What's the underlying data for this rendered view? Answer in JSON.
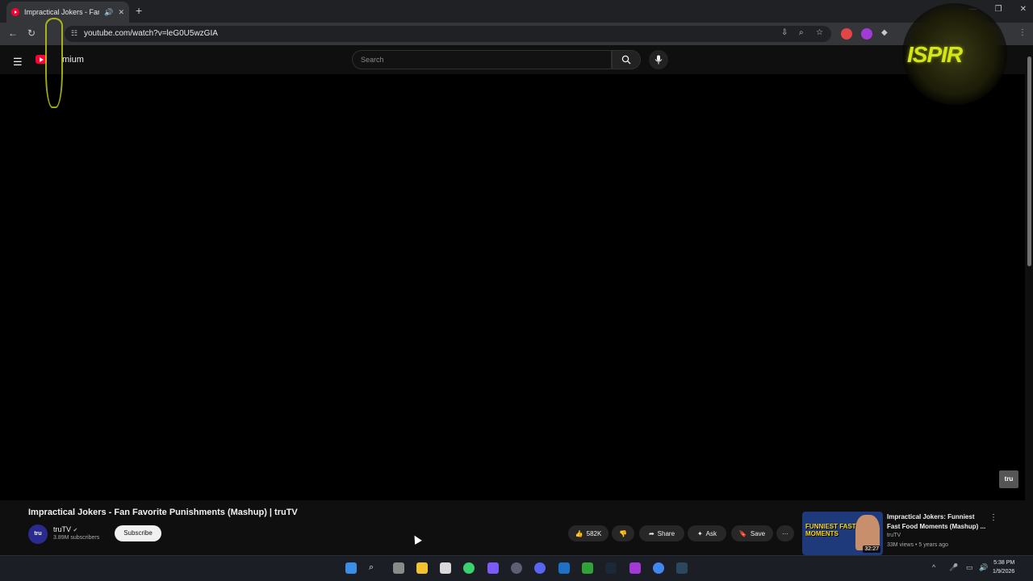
{
  "browser": {
    "tab_title": "Impractical Jokers - Fan Fav",
    "url": "youtube.com/watch?v=leG0U5wzGIA",
    "new_tab_label": "+",
    "icons": [
      "back-icon",
      "reload-icon",
      "install-icon",
      "zoom-icon",
      "bookmark-star-icon",
      "extensions-icon",
      "menu-kebab-icon"
    ]
  },
  "youtube": {
    "brand": "mium",
    "search_placeholder": "Search"
  },
  "player": {
    "watermark": "tru"
  },
  "overlay": {
    "text": "ISPIR"
  },
  "video": {
    "title": "Impractical Jokers - Fan Favorite Punishments (Mashup) | truTV",
    "channel": {
      "name": "truTV",
      "avatar_text": "tru",
      "subscribers": "3.89M subscribers",
      "subscribe_label": "Subscribe"
    },
    "actions": {
      "likes": "582K",
      "share": "Share",
      "ask": "Ask",
      "save": "Save",
      "more": "···"
    }
  },
  "suggestion": {
    "title": "Impractical Jokers: Funniest Fast Food Moments (Mashup) ...",
    "channel": "truTV",
    "meta": "33M views • 5 years ago",
    "duration": "32:27",
    "thumb_text": "FUNNIEST FAST FOOD MOMENTS"
  },
  "taskbar": {
    "time": "5:38 PM",
    "date": "1/9/2026"
  },
  "colors": {
    "yt_red": "#ff0033",
    "bg": "#0f0f0f",
    "overlay_yellow": "#d4e61a"
  }
}
